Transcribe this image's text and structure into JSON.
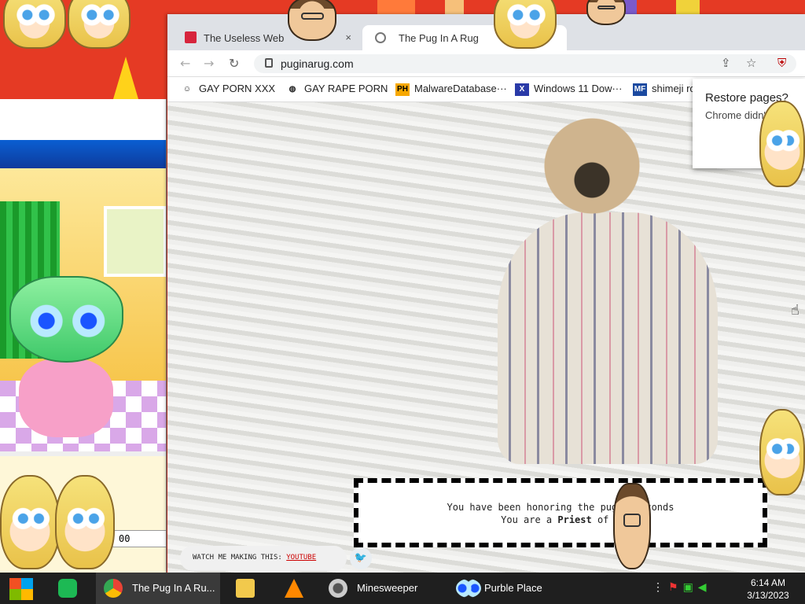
{
  "browser": {
    "tabs": [
      {
        "title": "The Useless Web",
        "active": false,
        "close_icon": "×"
      },
      {
        "title": "The Pug In A Rug",
        "active": true
      }
    ],
    "url": "puginarug.com",
    "bookmarks": [
      {
        "label": "GAY PORN XXX",
        "icon": "user-icon"
      },
      {
        "label": "GAY RAPE PORN",
        "icon": "globe-icon"
      },
      {
        "label": "MalwareDatabase···",
        "icon": "PH"
      },
      {
        "label": "Windows 11 Dow···",
        "icon": "X"
      },
      {
        "label": "shimeji ro",
        "icon": "MF"
      }
    ],
    "restore_popup": {
      "title": "Restore pages?",
      "body": "Chrome didn'"
    }
  },
  "page": {
    "honor_line1": "You have been honoring the pug f       seconds",
    "honor_line2_prefix": "You are a ",
    "honor_rank": "Priest",
    "honor_line2_suffix": " of p",
    "watch_label": "WATCH ME MAKING THIS: ",
    "watch_link": "YOUTUBE"
  },
  "purble": {
    "field_value": "00"
  },
  "taskbar": {
    "apps": [
      {
        "label": "",
        "icon": "spotify-icon",
        "color": "#1db954"
      },
      {
        "label": "The Pug In A Ru...",
        "icon": "chrome-icon"
      },
      {
        "label": "",
        "icon": "explorer-icon"
      },
      {
        "label": "",
        "icon": "vlc-icon"
      },
      {
        "label": "Minesweeper",
        "icon": "mine-icon"
      },
      {
        "label": "Purble Place",
        "icon": "eyes-icon"
      }
    ],
    "time": "6:14 AM",
    "date": "3/13/2023"
  },
  "colors": {
    "desktop": "#e53a24",
    "taskbar": "#1f1f1f",
    "accent": "#d7243c"
  }
}
